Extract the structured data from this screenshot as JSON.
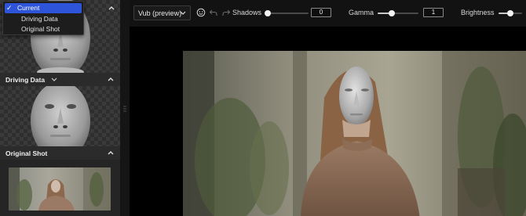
{
  "left_panel": {
    "dropdown": {
      "items": [
        {
          "label": "Current",
          "selected": true
        },
        {
          "label": "Driving Data",
          "selected": false
        },
        {
          "label": "Original Shot",
          "selected": false
        }
      ]
    },
    "sections": {
      "driving_data": {
        "title": "Driving Data"
      },
      "original_shot": {
        "title": "Original Shot"
      }
    }
  },
  "toolbar": {
    "model_select": {
      "value": "Vub (preview)"
    },
    "shadows": {
      "label": "Shadows",
      "value": "0",
      "level": 0
    },
    "gamma": {
      "label": "Gamma",
      "value": "1",
      "level": 0.35
    },
    "brightness": {
      "label": "Brightness",
      "level": 0.5
    }
  },
  "icons": {
    "face": "face-icon",
    "undo": "undo-icon",
    "redo": "redo-icon",
    "check": "checkmark-icon",
    "chevron": "chevron-down-icon",
    "collapse": "chevron-up-icon",
    "grip": "drag-handle-icon"
  },
  "colors": {
    "accent": "#2e55d9",
    "panel": "#252525",
    "toolbar": "#121212"
  }
}
